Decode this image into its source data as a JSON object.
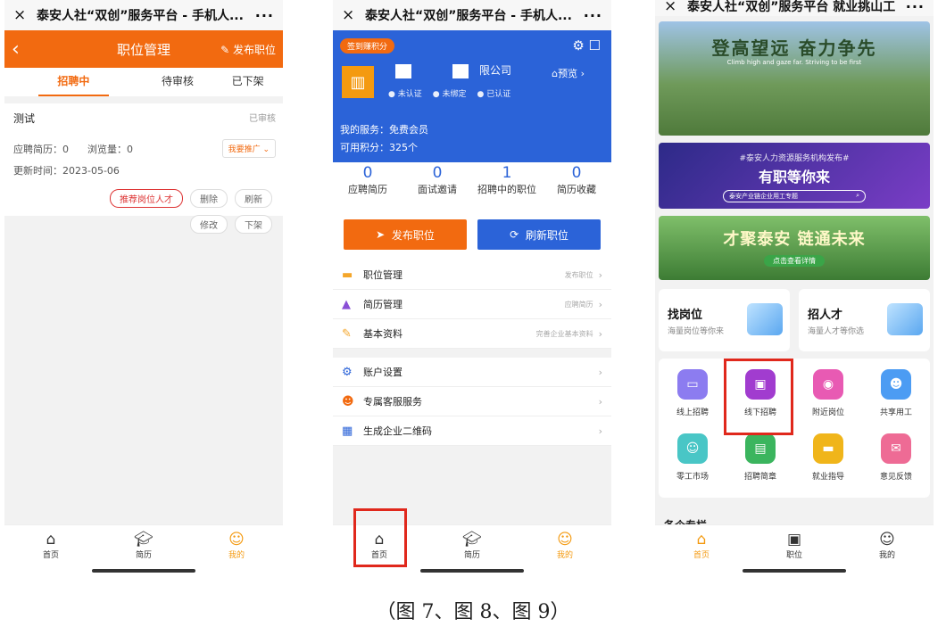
{
  "common": {
    "close_icon": "×",
    "more_icon": "···"
  },
  "phone1": {
    "window_title": "泰安人社“双创”服务平台 - 手机人...",
    "header": {
      "title": "职位管理",
      "publish": "发布职位"
    },
    "tabs": [
      "招聘中",
      "待审核",
      "已下架"
    ],
    "job": {
      "name": "测试",
      "status": "已审核",
      "applications": "应聘简历：0",
      "views": "浏览量：0",
      "promote": "我要推广",
      "updated": "更新时间：2023-05-06",
      "actions": [
        "推荐岗位人才",
        "删除",
        "刷新",
        "修改",
        "下架"
      ]
    },
    "nav": [
      "首页",
      "简历",
      "我的"
    ]
  },
  "phone2": {
    "window_title": "泰安人社“双创”服务平台 - 手机人...",
    "sign_in": "签到赚积分",
    "company_suffix": "限公司",
    "preview": "预览",
    "badges": [
      "未认证",
      "未绑定",
      "已认证"
    ],
    "service": "我的服务：免费会员",
    "points": "可用积分：325个",
    "stats": [
      {
        "value": "0",
        "label": "应聘简历"
      },
      {
        "value": "0",
        "label": "面试邀请"
      },
      {
        "value": "1",
        "label": "招聘中的职位"
      },
      {
        "value": "0",
        "label": "简历收藏"
      }
    ],
    "buttons": {
      "publish": "发布职位",
      "refresh": "刷新职位"
    },
    "menu1": [
      {
        "label": "职位管理",
        "hint": "发布职位"
      },
      {
        "label": "简历管理",
        "hint": "应聘简历"
      },
      {
        "label": "基本资料",
        "hint": "完善企业基本资料"
      }
    ],
    "menu2": [
      {
        "label": "账户设置",
        "hint": ""
      },
      {
        "label": "专属客服服务",
        "hint": ""
      },
      {
        "label": "生成企业二维码",
        "hint": ""
      }
    ],
    "nav": [
      "首页",
      "简历",
      "我的"
    ]
  },
  "phone3": {
    "window_title": "泰安人社“双创”服务平台 就业挑山工",
    "banner1": {
      "title": "登高望远 奋力争先",
      "subtitle": "Climb high and gaze far. Striving to be first"
    },
    "banner2": {
      "line1": "#泰安人力资源服务机构发布#",
      "line2": "有职等你来",
      "search": "泰安产业链企业用工专题"
    },
    "banner3": {
      "title": "才聚泰安 链通未来",
      "button": "点击查看详情"
    },
    "cards": [
      {
        "title": "找岗位",
        "sub": "海量岗位等你来"
      },
      {
        "title": "招人才",
        "sub": "海量人才等你选"
      }
    ],
    "grid": [
      {
        "label": "线上招聘",
        "color": "#8c7cf0"
      },
      {
        "label": "线下招聘",
        "color": "#a13ccf"
      },
      {
        "label": "附近岗位",
        "color": "#e85ab3"
      },
      {
        "label": "共享用工",
        "color": "#4c9cf3"
      },
      {
        "label": "零工市场",
        "color": "#49c6c6"
      },
      {
        "label": "招聘简章",
        "color": "#3bb55e"
      },
      {
        "label": "就业指导",
        "color": "#f0b51a"
      },
      {
        "label": "意见反馈",
        "color": "#ee6b95"
      }
    ],
    "more": "各个专栏",
    "nav": [
      "首页",
      "职位",
      "我的"
    ]
  },
  "caption": "（图 7、图 8、图 9）",
  "accent": "#f26a10",
  "blue": "#2b63d8"
}
